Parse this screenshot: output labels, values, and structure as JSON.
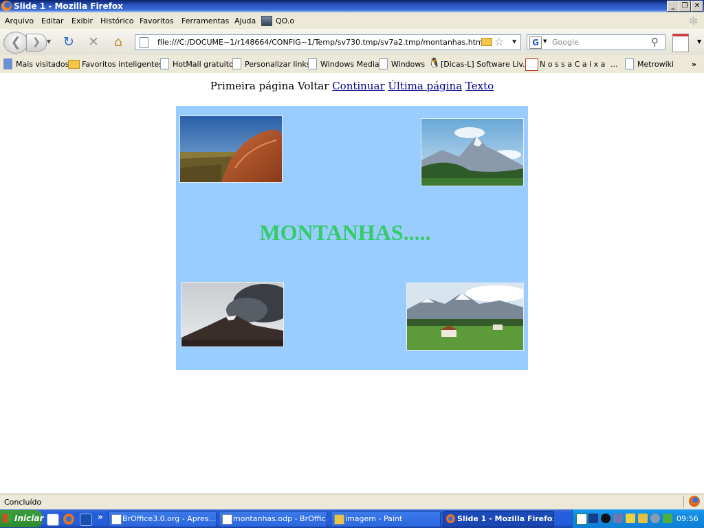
{
  "window": {
    "title": "Slide 1 - Mozilla Firefox",
    "controls": [
      "_",
      "❐",
      "✕"
    ]
  },
  "menubar": {
    "items": [
      "Arquivo",
      "Editar",
      "Exibir",
      "Histórico",
      "Favoritos",
      "Ferramentas",
      "Ajuda",
      "QO.o"
    ]
  },
  "toolbar": {
    "url": "file:///C:/DOCUME~1/r148664/CONFIG~1/Temp/sv730.tmp/sv7a2.tmp/montanhas.htm",
    "search_placeholder": "Google",
    "search_engine_letter": "G"
  },
  "bookmarks": {
    "items": [
      "Mais visitados",
      "Favoritos inteligentes",
      "HotMail gratuito",
      "Personalizar links",
      "Windows Media",
      "Windows",
      "[Dicas-L] Software Liv...",
      "N o s s a   C a i x a",
      "...",
      "Metrowiki"
    ],
    "overflow": "»"
  },
  "slide_nav": {
    "first": "Primeira página",
    "back": "Voltar",
    "continue": "Continuar",
    "last": "Última página",
    "text": "Texto"
  },
  "slide": {
    "title": "MONTANHAS.....",
    "bg_color": "#99ccff",
    "title_color": "#33cc66"
  },
  "status": {
    "text": "Concluído"
  },
  "taskbar": {
    "start_label": "Iniciar",
    "quicklaunch_more": "»",
    "tasks": [
      {
        "label": "BrOffice3.0.org - Apres...",
        "active": false
      },
      {
        "label": "montanhas.odp - BrOffic...",
        "active": false
      },
      {
        "label": "imagem - Paint",
        "active": false
      },
      {
        "label": "Slide 1 - Mozilla Firefox",
        "active": true
      }
    ],
    "clock": "09:56"
  },
  "colors": {
    "titlebar": "#0a246a",
    "chrome": "#ece9d8",
    "taskbar": "#245edb",
    "start": "#3c9b3c",
    "tray": "#138be0",
    "link": "#00008b"
  }
}
